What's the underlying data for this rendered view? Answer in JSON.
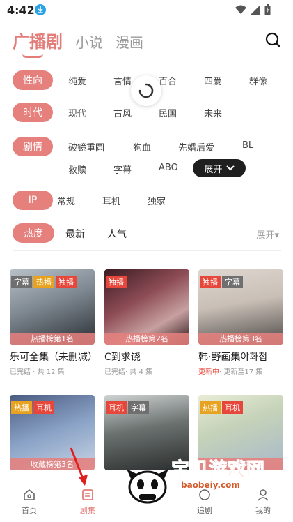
{
  "status": {
    "time": "4:42"
  },
  "tabs": [
    {
      "label": "广播剧",
      "active": true
    },
    {
      "label": "小说",
      "active": false
    },
    {
      "label": "漫画",
      "active": false
    }
  ],
  "filters": {
    "orientation": {
      "label": "性向",
      "options": [
        "纯爱",
        "言情",
        "百合",
        "四爱",
        "群像"
      ]
    },
    "era": {
      "label": "时代",
      "options": [
        "现代",
        "古风",
        "民国",
        "未来"
      ]
    },
    "plot": {
      "label": "剧情",
      "options": [
        "破镜重圆",
        "狗血",
        "先婚后爱",
        "BL",
        "救赎",
        "字幕",
        "ABO"
      ],
      "expand_label": "展开"
    },
    "type": {
      "label": "IP",
      "options": [
        "常规",
        "耳机",
        "独家"
      ]
    }
  },
  "sort": {
    "selected": "热度",
    "options": [
      "最新",
      "人气"
    ],
    "expand_label": "展开"
  },
  "cards": [
    {
      "badges": [
        {
          "text": "字幕",
          "color": "gray"
        },
        {
          "text": "热播",
          "color": "orange"
        },
        {
          "text": "独播",
          "color": "red"
        }
      ],
      "rank": "热播榜第1名",
      "title": "乐可全集（未删减）",
      "status": "已完结",
      "meta": " · 共 12 集"
    },
    {
      "badges": [
        {
          "text": "独播",
          "color": "red"
        }
      ],
      "rank": "热播榜第2名",
      "title": "C到求饶",
      "status": "已完结",
      "meta": "· 共 4 集"
    },
    {
      "badges": [
        {
          "text": "独播",
          "color": "red"
        },
        {
          "text": "字幕",
          "color": "gray"
        }
      ],
      "rank": "热播榜第3名",
      "title": "韩·野画集야화첩",
      "status": "更新中",
      "meta": "· 更新至17 集"
    },
    {
      "badges": [
        {
          "text": "热播",
          "color": "orange"
        },
        {
          "text": "耳机",
          "color": "red"
        }
      ],
      "rank": "收藏榜第3名",
      "title": "",
      "status": "",
      "meta": ""
    },
    {
      "badges": [
        {
          "text": "耳机",
          "color": "red"
        },
        {
          "text": "字幕",
          "color": "gray"
        }
      ],
      "rank": "",
      "title": "",
      "status": "",
      "meta": ""
    },
    {
      "badges": [
        {
          "text": "热播",
          "color": "orange"
        },
        {
          "text": "耳机",
          "color": "red"
        }
      ],
      "rank": "热播榜第5名",
      "title": "",
      "status": "",
      "meta": ""
    }
  ],
  "bottom_nav": [
    {
      "label": "首页",
      "icon": "home-icon",
      "active": false
    },
    {
      "label": "剧集",
      "icon": "episodes-icon",
      "active": true
    },
    {
      "label": "追剧",
      "icon": "follow-icon",
      "active": false
    },
    {
      "label": "我的",
      "icon": "profile-icon",
      "active": false
    }
  ],
  "watermark": {
    "text": "宝贝游戏网",
    "url": "baobeiy.com"
  },
  "colors": {
    "accent": "#e5807d",
    "badge_red": "#e7473a",
    "badge_orange": "#e8a21f",
    "badge_gray": "#6f6f6f"
  }
}
